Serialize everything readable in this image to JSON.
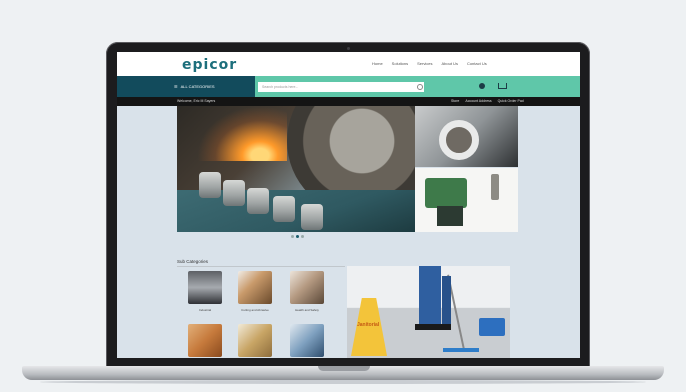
{
  "site": {
    "logo": "epicor",
    "nav": [
      "Home",
      "Solutions",
      "Services",
      "About Us",
      "Contact Us"
    ],
    "categories_button": "ALL CATEGORIES",
    "search_placeholder": "Search products here...",
    "welcome": "Welcome, Eric M Sayers",
    "sub_links": [
      "Store",
      "Account Address",
      "Quick Order Pad"
    ]
  },
  "hero": {
    "slide_count": 3,
    "active_slide": 2
  },
  "categories": {
    "title": "Sub Categories",
    "items": [
      {
        "label": "Industrial"
      },
      {
        "label": "Cutting and Abrasive"
      },
      {
        "label": "Health and Safety"
      },
      {
        "label": ""
      },
      {
        "label": ""
      },
      {
        "label": ""
      }
    ]
  },
  "promo": {
    "sign_text": "Janitorial"
  },
  "colors": {
    "brand": "#1d6f7c",
    "teal_bar": "#5fc7a9",
    "dark_navy": "#124b5c"
  }
}
